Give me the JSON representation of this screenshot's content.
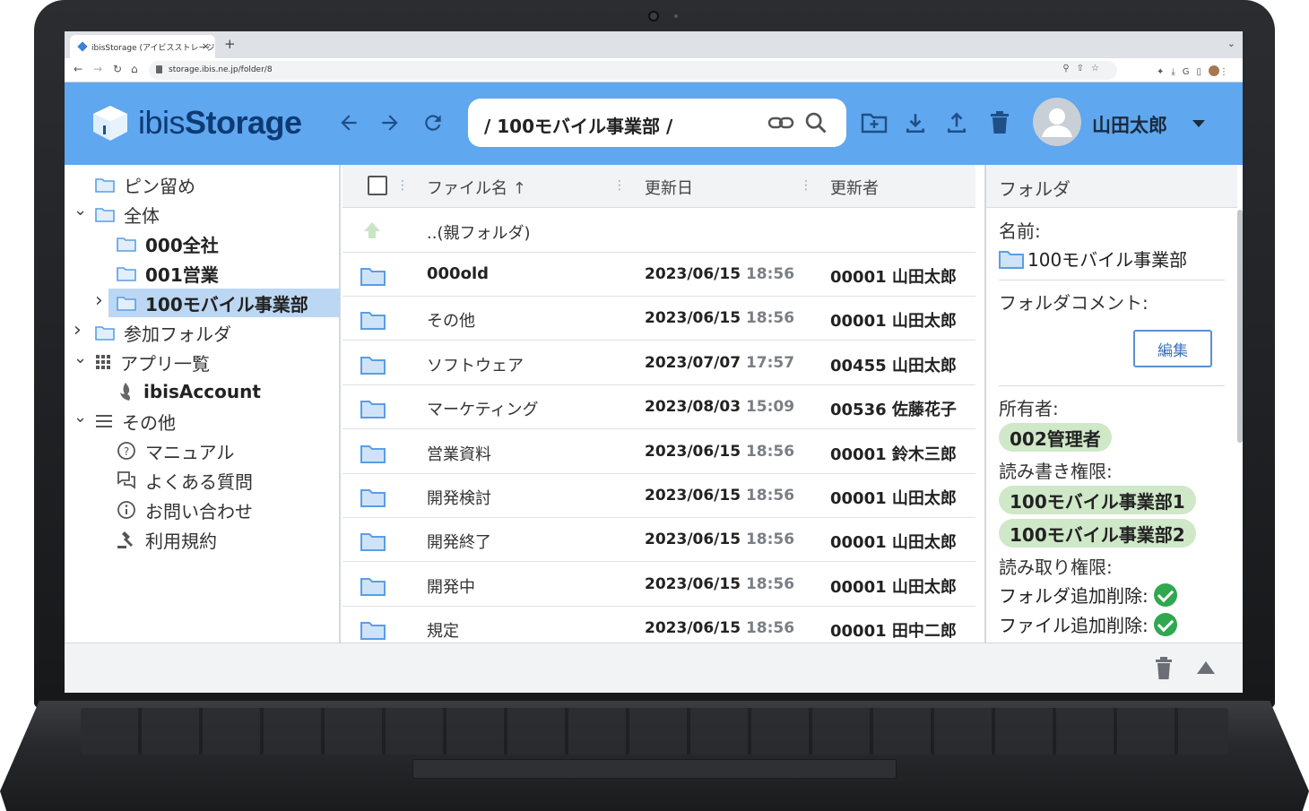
{
  "browser": {
    "tab_title": "ibisStorage (アイビスストレージ",
    "tab_close": "×",
    "new_tab": "+",
    "url": "storage.ibis.ne.jp/folder/8"
  },
  "header": {
    "logo_light": "ibis",
    "logo_bold": "Storage",
    "path": "/ 100モバイル事業部 /",
    "user_name": "山田太郎",
    "colors": {
      "header_bg": "#5fa7ef",
      "logo": "#0e3a73"
    }
  },
  "sidebar": {
    "items": [
      {
        "label": "ピン留め",
        "icon": "folder-icon"
      },
      {
        "label": "全体",
        "icon": "folder-icon",
        "caret": "expanded"
      },
      {
        "label": "000全社",
        "icon": "folder-icon"
      },
      {
        "label": "001営業",
        "icon": "folder-icon"
      },
      {
        "label": "100モバイル事業部",
        "icon": "folder-icon",
        "caret": "collapsed",
        "selected": true
      },
      {
        "label": "参加フォルダ",
        "icon": "folder-icon",
        "caret": "collapsed"
      },
      {
        "label": "アプリ一覧",
        "icon": "apps-grid-icon",
        "caret": "expanded"
      },
      {
        "label": "ibisAccount",
        "icon": "ibis-account-icon"
      },
      {
        "label": "その他",
        "icon": "menu-lines-icon",
        "caret": "expanded"
      },
      {
        "label": "マニュアル",
        "icon": "help-circle-icon"
      },
      {
        "label": "よくある質問",
        "icon": "chat-icon"
      },
      {
        "label": "お問い合わせ",
        "icon": "info-icon"
      },
      {
        "label": "利用規約",
        "icon": "gavel-icon"
      }
    ]
  },
  "filelist": {
    "columns": {
      "name": "ファイル名",
      "updated": "更新日",
      "updater": "更新者"
    },
    "parent": "..(親フォルダ)",
    "rows": [
      {
        "name": "000old",
        "date": "2023/06/15",
        "time": "18:56",
        "user": "00001 山田太郎"
      },
      {
        "name": "その他",
        "date": "2023/06/15",
        "time": "18:56",
        "user": "00001 山田太郎"
      },
      {
        "name": "ソフトウェア",
        "date": "2023/07/07",
        "time": "17:57",
        "user": "00455 山田太郎"
      },
      {
        "name": "マーケティング",
        "date": "2023/08/03",
        "time": "15:09",
        "user": "00536 佐藤花子"
      },
      {
        "name": "営業資料",
        "date": "2023/06/15",
        "time": "18:56",
        "user": "00001 鈴木三郎"
      },
      {
        "name": "開発検討",
        "date": "2023/06/15",
        "time": "18:56",
        "user": "00001 山田太郎"
      },
      {
        "name": "開発終了",
        "date": "2023/06/15",
        "time": "18:56",
        "user": "00001 山田太郎"
      },
      {
        "name": "開発中",
        "date": "2023/06/15",
        "time": "18:56",
        "user": "00001 山田太郎"
      },
      {
        "name": "規定",
        "date": "2023/06/15",
        "time": "18:56",
        "user": "00001 田中二郎"
      }
    ]
  },
  "detail": {
    "title": "フォルダ",
    "name_label": "名前:",
    "name_value": "100モバイル事業部",
    "comment_label": "フォルダコメント:",
    "edit_button": "編集",
    "owner_label": "所有者:",
    "owner_value": "002管理者",
    "rw_label": "読み書き権限:",
    "rw_values": [
      "100モバイル事業部1",
      "100モバイル事業部2"
    ],
    "read_label": "読み取り権限:",
    "folder_edit_label": "フォルダ追加削除:",
    "file_edit_label": "ファイル追加削除:",
    "colors": {
      "chip": "#cfe8c8",
      "check": "#2fa84f"
    }
  }
}
